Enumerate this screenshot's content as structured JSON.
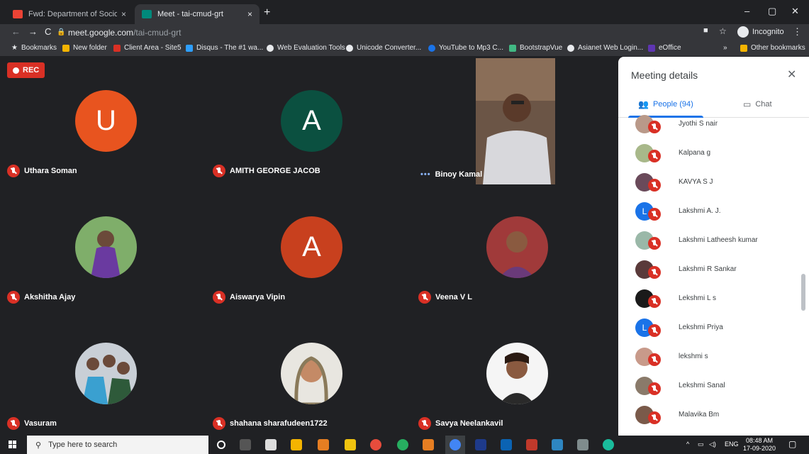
{
  "browser": {
    "tabs": [
      {
        "title": "Fwd: Department of Sociology, S",
        "close": "×"
      },
      {
        "title": "Meet - tai-cmud-grt",
        "close": "×"
      }
    ],
    "new_tab": "+",
    "url_host": "meet.google.com",
    "url_path": "/tai-cmud-grt",
    "incognito_label": "Incognito",
    "window_controls": [
      "–",
      "▢",
      "✕"
    ],
    "nav": [
      "←",
      "→",
      "C"
    ],
    "bookmarks": [
      "Bookmarks",
      "New folder",
      "Client Area - Site5",
      "Disqus - The #1 wa...",
      "Web Evaluation Tools",
      "Unicode Converter...",
      "YouTube to Mp3 C...",
      "BootstrapVue",
      "Asianet Web Login...",
      "eOffice"
    ],
    "bookmarks_more": "»",
    "other_bookmarks": "Other bookmarks"
  },
  "meeting": {
    "rec_label": "REC",
    "tiles": [
      {
        "name": "Uthara Soman",
        "initial": "U",
        "color": "#e8541f"
      },
      {
        "name": "AMITH GEORGE JACOB",
        "initial": "A",
        "color": "#0b5040"
      },
      {
        "name": "Akshitha Ajay"
      },
      {
        "name": "Aiswarya Vipin",
        "initial": "A",
        "color": "#c8401e"
      },
      {
        "name": "Veena V L"
      },
      {
        "name": "Vasuram"
      },
      {
        "name": "shahana sharafudeen1722"
      },
      {
        "name": "Savya Neelankavil"
      }
    ],
    "presenter": {
      "name": "Binoy Kamal",
      "dots": "•••"
    }
  },
  "panel": {
    "title": "Meeting details",
    "close": "✕",
    "people_tab": "People (94)",
    "chat_tab": "Chat",
    "people": [
      {
        "name": "Jyothi S nair",
        "initial": ""
      },
      {
        "name": "Kalpana g",
        "initial": ""
      },
      {
        "name": "KAVYA S J",
        "initial": ""
      },
      {
        "name": "Lakshmi A. J.",
        "initial": "L"
      },
      {
        "name": "Lakshmi Latheesh kumar",
        "initial": ""
      },
      {
        "name": "Lakshmi R Sankar",
        "initial": ""
      },
      {
        "name": "Lekshmi L s",
        "initial": ""
      },
      {
        "name": "Lekshmi Priya",
        "initial": "L"
      },
      {
        "name": "lekshmi s",
        "initial": ""
      },
      {
        "name": "Lekshmi Sanal",
        "initial": ""
      },
      {
        "name": "Malavika Bm",
        "initial": ""
      }
    ]
  },
  "taskbar": {
    "search_placeholder": "Type here to search",
    "tray_lang": "ENG",
    "time": "08:48 AM",
    "date": "17-09-2020"
  }
}
